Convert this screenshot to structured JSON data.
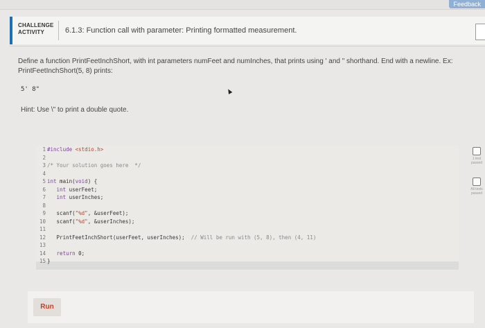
{
  "feedback_label": "Feedback",
  "header": {
    "badge_line1": "CHALLENGE",
    "badge_line2": "ACTIVITY",
    "title": "6.1.3: Function call with parameter: Printing formatted measurement."
  },
  "description": "Define a function PrintFeetInchShort, with int parameters numFeet and numInches, that prints using ' and \" shorthand. End with a newline. Ex: PrintFeetInchShort(5, 8) prints:",
  "example_output": "5' 8\"",
  "hint": "Hint: Use \\\" to print a double quote.",
  "editor": {
    "line_numbers": [
      "1",
      "2",
      "3",
      "4",
      "5",
      "6",
      "7",
      "8",
      "9",
      "10",
      "11",
      "12",
      "13",
      "14",
      "15"
    ],
    "lines": [
      {
        "parts": [
          {
            "cls": "dir",
            "text": "#include "
          },
          {
            "cls": "str",
            "text": "<stdio.h>"
          }
        ]
      },
      {
        "parts": [
          {
            "cls": "plain",
            "text": ""
          }
        ]
      },
      {
        "parts": [
          {
            "cls": "cm",
            "text": "/* Your solution goes here  */"
          }
        ]
      },
      {
        "parts": [
          {
            "cls": "plain",
            "text": ""
          }
        ]
      },
      {
        "parts": [
          {
            "cls": "kw",
            "text": "int"
          },
          {
            "cls": "plain",
            "text": " main("
          },
          {
            "cls": "kw",
            "text": "void"
          },
          {
            "cls": "plain",
            "text": ") {"
          }
        ]
      },
      {
        "parts": [
          {
            "cls": "plain",
            "text": "   "
          },
          {
            "cls": "kw",
            "text": "int"
          },
          {
            "cls": "plain",
            "text": " userFeet;"
          }
        ]
      },
      {
        "parts": [
          {
            "cls": "plain",
            "text": "   "
          },
          {
            "cls": "kw",
            "text": "int"
          },
          {
            "cls": "plain",
            "text": " userInches;"
          }
        ]
      },
      {
        "parts": [
          {
            "cls": "plain",
            "text": ""
          }
        ]
      },
      {
        "parts": [
          {
            "cls": "plain",
            "text": "   scanf("
          },
          {
            "cls": "str",
            "text": "\"%d\""
          },
          {
            "cls": "plain",
            "text": ", &userFeet);"
          }
        ]
      },
      {
        "parts": [
          {
            "cls": "plain",
            "text": "   scanf("
          },
          {
            "cls": "str",
            "text": "\"%d\""
          },
          {
            "cls": "plain",
            "text": ", &userInches);"
          }
        ]
      },
      {
        "parts": [
          {
            "cls": "plain",
            "text": ""
          }
        ]
      },
      {
        "parts": [
          {
            "cls": "plain",
            "text": "   PrintFeetInchShort(userFeet, userInches);  "
          },
          {
            "cls": "cm",
            "text": "// Will be run with (5, 8), then (4, 11)"
          }
        ]
      },
      {
        "parts": [
          {
            "cls": "plain",
            "text": ""
          }
        ]
      },
      {
        "parts": [
          {
            "cls": "plain",
            "text": "   "
          },
          {
            "cls": "kw",
            "text": "return"
          },
          {
            "cls": "plain",
            "text": " 0;"
          }
        ]
      },
      {
        "parts": [
          {
            "cls": "plain",
            "text": "}"
          }
        ]
      }
    ]
  },
  "run_label": "Run",
  "side": {
    "test1_line1": "1 test",
    "test1_line2": "passed",
    "test2_line1": "All tests",
    "test2_line2": "passed"
  },
  "colors": {
    "accent": "#1c6fb5",
    "run_text": "#b8452a",
    "keyword": "#7b3fa0",
    "string": "#b0462a"
  }
}
